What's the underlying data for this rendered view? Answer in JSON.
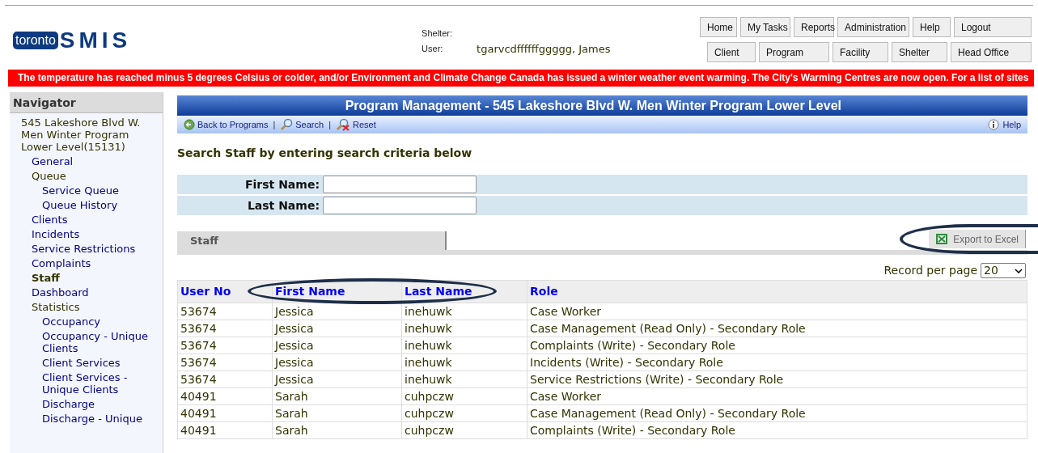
{
  "header": {
    "logo": {
      "left": "toronto",
      "right": "SMIS"
    },
    "shelter_label": "Shelter:",
    "user_label": "User:",
    "user_value": "tgarvcdffffffggggg, James",
    "top_buttons": [
      "Home",
      "My Tasks",
      "Reports",
      "Administration",
      "Help",
      "Logout"
    ],
    "module_buttons": [
      "Client",
      "Program",
      "Facility",
      "Shelter",
      "Head Office"
    ]
  },
  "alert_banner": "The temperature has reached minus 5 degrees Celsius or colder, and/or Environment and Climate Change Canada has issued a winter weather event warming. The City's Warming Centres are now open. For a list of sites",
  "navigator": {
    "title": "Navigator",
    "items": [
      {
        "label": "545 Lakeshore Blvd W. Men Winter Program Lower Level(15131)",
        "children": [
          {
            "label": "General",
            "selected": false
          },
          {
            "label": "Queue",
            "selected": false,
            "children": [
              {
                "label": "Service Queue",
                "selected": false
              },
              {
                "label": "Queue History",
                "selected": false
              }
            ]
          },
          {
            "label": "Clients",
            "selected": false
          },
          {
            "label": "Incidents",
            "selected": false
          },
          {
            "label": "Service Restrictions",
            "selected": false
          },
          {
            "label": "Complaints",
            "selected": false
          },
          {
            "label": "Staff",
            "selected": true
          },
          {
            "label": "Dashboard",
            "selected": false
          },
          {
            "label": "Statistics",
            "selected": false,
            "children": [
              {
                "label": "Occupancy",
                "selected": false
              },
              {
                "label": "Occupancy - Unique Clients",
                "selected": false
              },
              {
                "label": "Client Services",
                "selected": false
              },
              {
                "label": "Client Services - Unique Clients",
                "selected": false
              },
              {
                "label": "Discharge",
                "selected": false
              },
              {
                "label": "Discharge - Unique",
                "selected": false
              }
            ]
          }
        ]
      }
    ]
  },
  "page_title": "Program Management - 545 Lakeshore Blvd W. Men Winter Program Lower Level",
  "toolbar": {
    "actions": [
      {
        "kind": "back",
        "label": "Back to Programs"
      },
      {
        "kind": "search",
        "label": "Search"
      },
      {
        "kind": "reset",
        "label": "Reset"
      }
    ],
    "separator": "|",
    "help": "Help"
  },
  "search_heading": "Search Staff by entering search criteria below",
  "search_fields": [
    {
      "label": "First Name:"
    },
    {
      "label": "Last Name:"
    }
  ],
  "section_tab": "Staff",
  "export_button": "Export to Excel",
  "records_per_page": {
    "label": "Record per page",
    "value": "20"
  },
  "table": {
    "columns": [
      "User No",
      "First Name",
      "Last Name",
      "Role"
    ],
    "rows": [
      [
        "53674",
        "Jessica",
        "inehuwk",
        "Case Worker"
      ],
      [
        "53674",
        "Jessica",
        "inehuwk",
        "Case Management (Read Only) - Secondary Role"
      ],
      [
        "53674",
        "Jessica",
        "inehuwk",
        "Complaints (Write) - Secondary Role"
      ],
      [
        "53674",
        "Jessica",
        "inehuwk",
        "Incidents (Write) - Secondary Role"
      ],
      [
        "53674",
        "Jessica",
        "inehuwk",
        "Service Restrictions (Write) - Secondary Role"
      ],
      [
        "40491",
        "Sarah",
        "cuhpczw",
        "Case Worker"
      ],
      [
        "40491",
        "Sarah",
        "cuhpczw",
        "Case Management (Read Only) - Secondary Role"
      ],
      [
        "40491",
        "Sarah",
        "cuhpczw",
        "Complaints (Write) - Secondary Role"
      ]
    ]
  }
}
